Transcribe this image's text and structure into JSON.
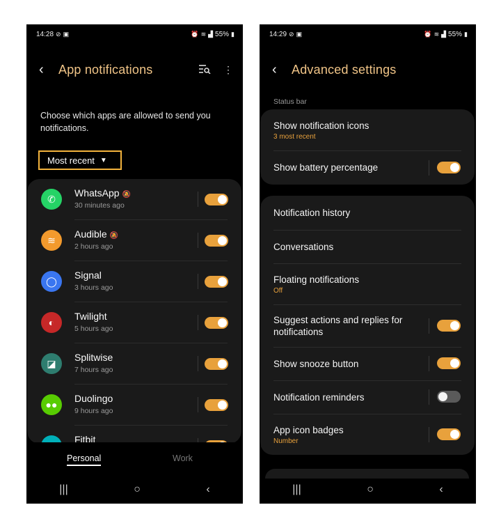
{
  "left_phone": {
    "status": {
      "time": "14:28",
      "battery": "55%"
    },
    "header": {
      "title": "App notifications"
    },
    "description": "Choose which apps are allowed to send you notifications.",
    "sort_dropdown": {
      "selected": "Most recent"
    },
    "apps": [
      {
        "name": "WhatsApp",
        "time": "30 minutes ago",
        "muted": true,
        "enabled": true,
        "color": "#25d366"
      },
      {
        "name": "Audible",
        "time": "2 hours ago",
        "muted": true,
        "enabled": true,
        "color": "#f39a2d"
      },
      {
        "name": "Signal",
        "time": "3 hours ago",
        "muted": false,
        "enabled": true,
        "color": "#3a76f0"
      },
      {
        "name": "Twilight",
        "time": "5 hours ago",
        "muted": false,
        "enabled": true,
        "color": "#c62828"
      },
      {
        "name": "Splitwise",
        "time": "7 hours ago",
        "muted": false,
        "enabled": true,
        "color": "#2e7d6f"
      },
      {
        "name": "Duolingo",
        "time": "9 hours ago",
        "muted": false,
        "enabled": true,
        "color": "#58cc02"
      },
      {
        "name": "Fitbit",
        "time": "",
        "muted": false,
        "enabled": true,
        "color": "#00b0b9"
      }
    ],
    "tabs": {
      "personal": "Personal",
      "work": "Work"
    }
  },
  "right_phone": {
    "status": {
      "time": "14:29",
      "battery": "55%"
    },
    "header": {
      "title": "Advanced settings"
    },
    "section_label": "Status bar",
    "status_bar_settings": [
      {
        "label": "Show notification icons",
        "sub": "3 most recent",
        "has_toggle": false
      },
      {
        "label": "Show battery percentage",
        "sub": "",
        "has_toggle": true,
        "enabled": true
      }
    ],
    "general_settings": [
      {
        "label": "Notification history",
        "sub": "",
        "has_toggle": false
      },
      {
        "label": "Conversations",
        "sub": "",
        "has_toggle": false
      },
      {
        "label": "Floating notifications",
        "sub": "Off",
        "has_toggle": false
      },
      {
        "label": "Suggest actions and replies for notifications",
        "sub": "",
        "has_toggle": true,
        "enabled": true
      },
      {
        "label": "Show snooze button",
        "sub": "",
        "has_toggle": true,
        "enabled": true
      },
      {
        "label": "Notification reminders",
        "sub": "",
        "has_toggle": true,
        "enabled": false
      },
      {
        "label": "App icon badges",
        "sub": "Number",
        "has_toggle": true,
        "enabled": true
      }
    ]
  },
  "colors": {
    "accent": "#e8a13c",
    "title": "#f0c487",
    "highlight_border": "#f3b33d",
    "card": "#1a1a1a"
  }
}
